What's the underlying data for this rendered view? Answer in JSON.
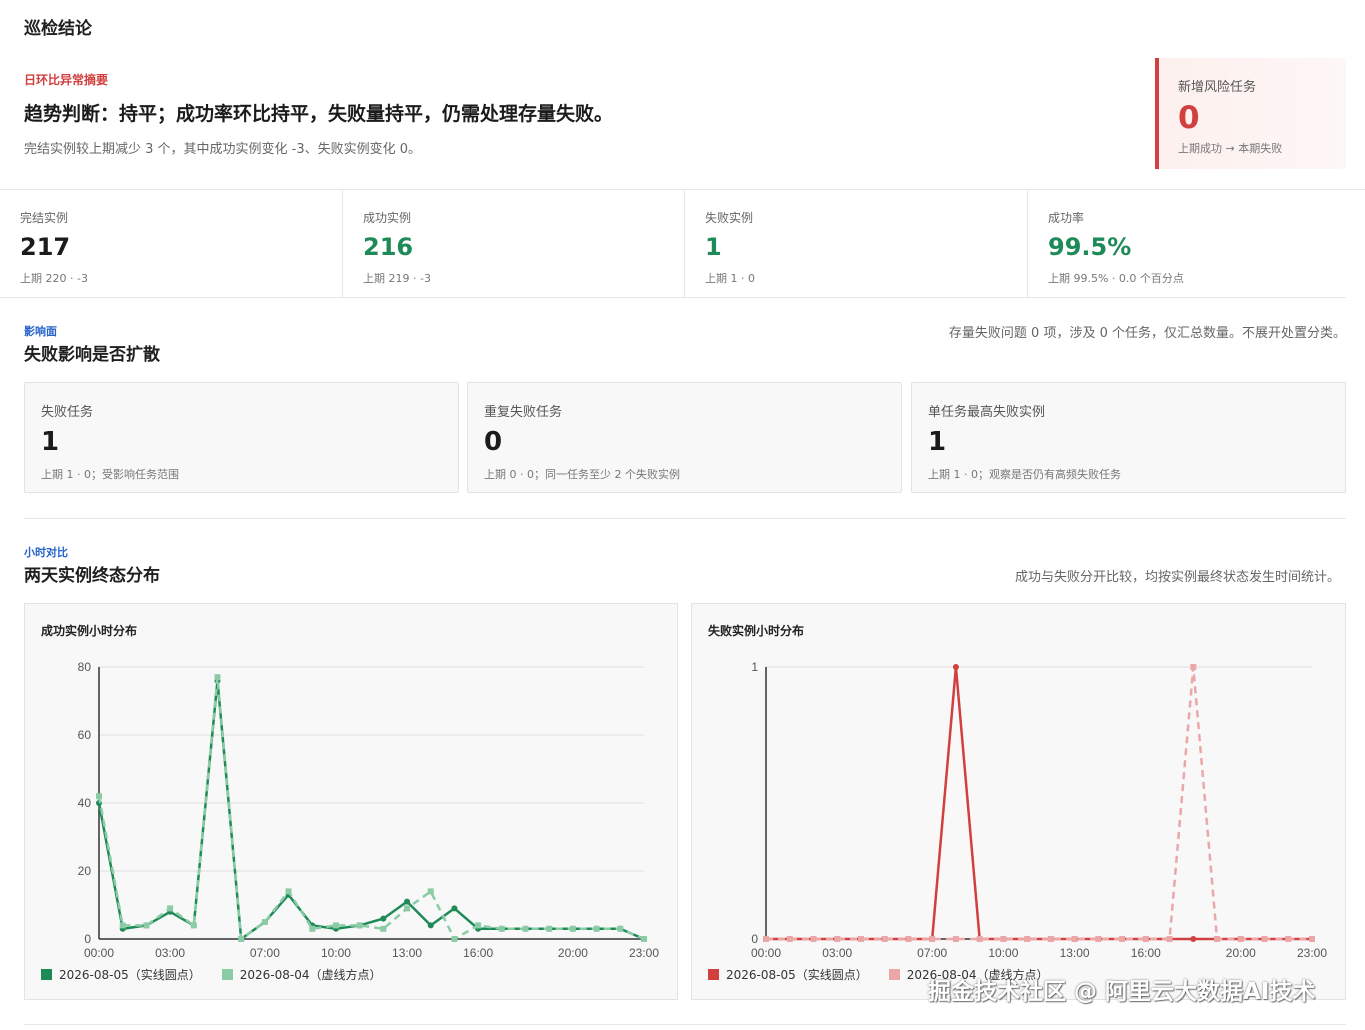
{
  "page_title": "巡检结论",
  "summary": {
    "eyebrow": "日环比异常摘要",
    "headline": "趋势判断：持平；成功率环比持平，失败量持平，仍需处理存量失败。",
    "subline": "完结实例较上期减少 3 个，其中成功实例变化 -3、失败实例变化 0。"
  },
  "risk_card": {
    "label": "新增风险任务",
    "value": "0",
    "note": "上期成功 → 本期失败",
    "accent_color": "#d23f3f"
  },
  "stats": [
    {
      "label": "完结实例",
      "value": "217",
      "note": "上期 220 · -3"
    },
    {
      "label": "成功实例",
      "value": "216",
      "note": "上期 219 · -3"
    },
    {
      "label": "失败实例",
      "value": "1",
      "note": "上期 1 · 0"
    },
    {
      "label": "成功率",
      "value": "99.5%",
      "note": "上期 99.5% · 0.0 个百分点"
    }
  ],
  "impact": {
    "eyebrow": "影响面",
    "title": "失败影响是否扩散",
    "note": "存量失败问题 0 项，涉及 0 个任务，仅汇总数量。不展开处置分类。",
    "cards": [
      {
        "label": "失败任务",
        "value": "1",
        "note": "上期 1 · 0；受影响任务范围"
      },
      {
        "label": "重复失败任务",
        "value": "0",
        "note": "上期 0 · 0；同一任务至少 2 个失败实例"
      },
      {
        "label": "单任务最高失败实例",
        "value": "1",
        "note": "上期 1 · 0；观察是否仍有高频失败任务"
      }
    ]
  },
  "hourly": {
    "eyebrow": "小时对比",
    "title": "两天实例终态分布",
    "note": "成功与失败分开比较，均按实例最终状态发生时间统计。"
  },
  "chart_data": [
    {
      "type": "line",
      "title": "成功实例小时分布",
      "x": [
        "00:00",
        "01:00",
        "02:00",
        "03:00",
        "04:00",
        "05:00",
        "06:00",
        "07:00",
        "08:00",
        "09:00",
        "10:00",
        "11:00",
        "12:00",
        "13:00",
        "14:00",
        "15:00",
        "16:00",
        "17:00",
        "18:00",
        "19:00",
        "20:00",
        "21:00",
        "22:00",
        "23:00"
      ],
      "x_tick_labels": [
        "00:00",
        "03:00",
        "07:00",
        "10:00",
        "13:00",
        "16:00",
        "20:00",
        "23:00"
      ],
      "y_ticks": [
        0,
        20,
        40,
        60,
        80
      ],
      "ylim": [
        0,
        80
      ],
      "grid": true,
      "legend_position": "bottom-left",
      "series": [
        {
          "name": "2026-08-05（实线圆点）",
          "color": "#1e8a57",
          "style": "solid",
          "marker": "circle",
          "values": [
            40,
            3,
            4,
            8,
            4,
            76,
            0,
            5,
            13,
            4,
            3,
            4,
            6,
            11,
            4,
            9,
            3,
            3,
            3,
            3,
            3,
            3,
            3,
            0
          ]
        },
        {
          "name": "2026-08-04（虚线方点）",
          "color": "#8bcca6",
          "style": "dashed",
          "marker": "square",
          "values": [
            42,
            4,
            4,
            9,
            4,
            77,
            0,
            5,
            14,
            3,
            4,
            4,
            3,
            9,
            14,
            0,
            4,
            3,
            3,
            3,
            3,
            3,
            3,
            0
          ]
        }
      ]
    },
    {
      "type": "line",
      "title": "失败实例小时分布",
      "x": [
        "00:00",
        "01:00",
        "02:00",
        "03:00",
        "04:00",
        "05:00",
        "06:00",
        "07:00",
        "08:00",
        "09:00",
        "10:00",
        "11:00",
        "12:00",
        "13:00",
        "14:00",
        "15:00",
        "16:00",
        "17:00",
        "18:00",
        "19:00",
        "20:00",
        "21:00",
        "22:00",
        "23:00"
      ],
      "x_tick_labels": [
        "00:00",
        "03:00",
        "07:00",
        "10:00",
        "13:00",
        "16:00",
        "20:00",
        "23:00"
      ],
      "y_ticks": [
        0,
        1
      ],
      "ylim": [
        0,
        1
      ],
      "grid": true,
      "legend_position": "bottom-left",
      "series": [
        {
          "name": "2026-08-05（实线圆点）",
          "color": "#d23f3f",
          "style": "solid",
          "marker": "circle",
          "values": [
            0,
            0,
            0,
            0,
            0,
            0,
            0,
            0,
            1,
            0,
            0,
            0,
            0,
            0,
            0,
            0,
            0,
            0,
            0,
            0,
            0,
            0,
            0,
            0
          ]
        },
        {
          "name": "2026-08-04（虚线方点）",
          "color": "#eba7a7",
          "style": "dashed",
          "marker": "square",
          "values": [
            0,
            0,
            0,
            0,
            0,
            0,
            0,
            0,
            0,
            0,
            0,
            0,
            0,
            0,
            0,
            0,
            0,
            0,
            1,
            0,
            0,
            0,
            0,
            0
          ]
        }
      ]
    }
  ],
  "watermark": "掘金技术社区 @ 阿里云大数据AI技术"
}
